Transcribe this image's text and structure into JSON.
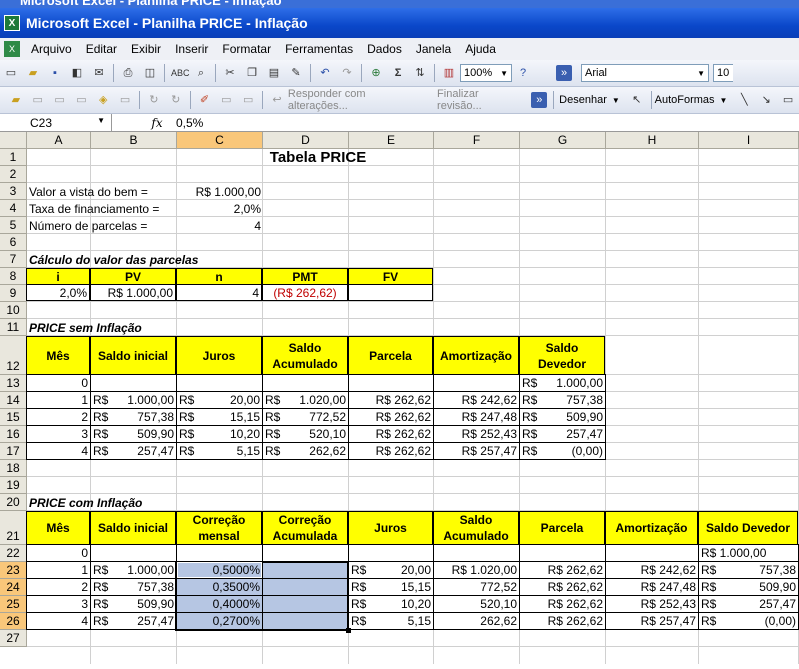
{
  "window": {
    "title": "Microsoft Excel - Planilha PRICE - Inflação",
    "ghost_title": "Microsoft Excel - Planilha PRICE - Inflação"
  },
  "menu": [
    "Arquivo",
    "Editar",
    "Exibir",
    "Inserir",
    "Formatar",
    "Ferramentas",
    "Dados",
    "Janela",
    "Ajuda"
  ],
  "toolbar": {
    "zoom": "100%",
    "font": "Arial",
    "font_size": "10",
    "review_reply": "Responder com alterações...",
    "review_end": "Finalizar revisão...",
    "draw": "Desenhar",
    "autoshapes": "AutoFormas"
  },
  "formula_bar": {
    "name_box": "C23",
    "fx": "fx",
    "content": "0,5%"
  },
  "columns": [
    "A",
    "B",
    "C",
    "D",
    "E",
    "F",
    "G",
    "H",
    "I"
  ],
  "rows": [
    "1",
    "2",
    "3",
    "4",
    "5",
    "6",
    "7",
    "8",
    "9",
    "10",
    "11",
    "12",
    "13",
    "14",
    "15",
    "16",
    "17",
    "18",
    "19",
    "20",
    "21",
    "22",
    "23",
    "24",
    "25",
    "26",
    "27"
  ],
  "sheet": {
    "title": "Tabela PRICE",
    "inputs": [
      {
        "label": "Valor a vista do bem =",
        "value": "R$  1.000,00"
      },
      {
        "label": "Taxa de financiamento =",
        "value": "2,0%"
      },
      {
        "label": "Número de parcelas =",
        "value": "4"
      }
    ],
    "calc_title": "Cálculo do valor das parcelas",
    "calc_headers": [
      "i",
      "PV",
      "n",
      "PMT",
      "FV"
    ],
    "calc_values": [
      "2,0%",
      "R$  1.000,00",
      "4",
      "(R$ 262,62)",
      ""
    ],
    "price_sem_title": "PRICE sem Inflação",
    "sem_headers": [
      "Mês",
      "Saldo inicial",
      "Juros",
      "Saldo Acumulado",
      "Parcela",
      "Amortização",
      "Saldo Devedor"
    ],
    "sem_rows": [
      {
        "mes": "0",
        "saldo_ini": "",
        "juros": "",
        "acum": "",
        "parcela": "",
        "amort": "",
        "devedor": "1.000,00"
      },
      {
        "mes": "1",
        "saldo_ini": "1.000,00",
        "juros": "20,00",
        "acum": "1.020,00",
        "parcela": "R$ 262,62",
        "amort": "R$ 242,62",
        "devedor": "757,38"
      },
      {
        "mes": "2",
        "saldo_ini": "757,38",
        "juros": "15,15",
        "acum": "772,52",
        "parcela": "R$ 262,62",
        "amort": "R$ 247,48",
        "devedor": "509,90"
      },
      {
        "mes": "3",
        "saldo_ini": "509,90",
        "juros": "10,20",
        "acum": "520,10",
        "parcela": "R$ 262,62",
        "amort": "R$ 252,43",
        "devedor": "257,47"
      },
      {
        "mes": "4",
        "saldo_ini": "257,47",
        "juros": "5,15",
        "acum": "262,62",
        "parcela": "R$ 262,62",
        "amort": "R$ 257,47",
        "devedor": "(0,00)"
      }
    ],
    "price_com_title": "PRICE com Inflação",
    "com_headers": [
      "Mês",
      "Saldo inicial",
      "Correção mensal",
      "Correção Acumulada",
      "Juros",
      "Saldo Acumulado",
      "Parcela",
      "Amortização",
      "Saldo Devedor"
    ],
    "com_rows": [
      {
        "mes": "0",
        "saldo_ini": "",
        "corr": "",
        "corr_acum": "",
        "juros": "",
        "acum": "",
        "parcela": "",
        "amort": "",
        "devedor": "R$ 1.000,00"
      },
      {
        "mes": "1",
        "saldo_ini": "1.000,00",
        "corr": "0,5000%",
        "corr_acum": "",
        "juros": "20,00",
        "acum": "R$ 1.020,00",
        "parcela": "R$ 262,62",
        "amort": "R$ 242,62",
        "devedor": "757,38"
      },
      {
        "mes": "2",
        "saldo_ini": "757,38",
        "corr": "0,3500%",
        "corr_acum": "",
        "juros": "15,15",
        "acum": "772,52",
        "parcela": "R$ 262,62",
        "amort": "R$ 247,48",
        "devedor": "509,90"
      },
      {
        "mes": "3",
        "saldo_ini": "509,90",
        "corr": "0,4000%",
        "corr_acum": "",
        "juros": "10,20",
        "acum": "520,10",
        "parcela": "R$ 262,62",
        "amort": "R$ 252,43",
        "devedor": "257,47"
      },
      {
        "mes": "4",
        "saldo_ini": "257,47",
        "corr": "0,2700%",
        "corr_acum": "",
        "juros": "5,15",
        "acum": "262,62",
        "parcela": "R$ 262,62",
        "amort": "R$ 257,47",
        "devedor": "(0,00)"
      }
    ],
    "currency": "R$"
  },
  "colors": {
    "header_fill": "#ffff00",
    "selection_fill": "#b6c6e3",
    "negative": "#c00000",
    "active_header": "#f9c77a"
  }
}
